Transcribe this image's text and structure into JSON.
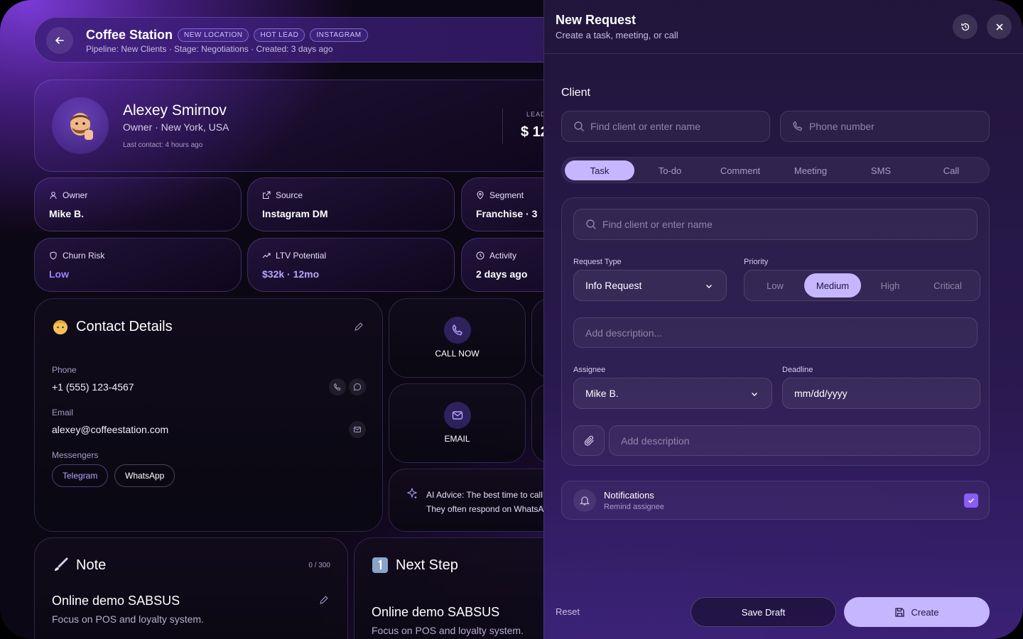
{
  "header": {
    "title": "Coffee Station",
    "tags": [
      "NEW LOCATION",
      "HOT LEAD",
      "INSTAGRAM"
    ],
    "subtitle": "Pipeline: New Clients · Stage: Negotiations · Created: 3 days ago"
  },
  "profile": {
    "name": "Alexey Smirnov",
    "role": "Owner · New York, USA",
    "last_contact": "Last contact: 4 hours ago",
    "lead_label": "LEAD",
    "lead_value": "$ 12"
  },
  "stats": [
    {
      "label": "Owner",
      "value": "Mike B."
    },
    {
      "label": "Source",
      "value": "Instagram DM"
    },
    {
      "label": "Segment",
      "value": "Franchise · 3"
    },
    {
      "label": "Churn Risk",
      "value": "Low"
    },
    {
      "label": "LTV Potential",
      "value": "$32k · 12mo"
    },
    {
      "label": "Activity",
      "value": "2 days ago"
    }
  ],
  "contact": {
    "title": "Contact Details",
    "phone_label": "Phone",
    "phone": "+1 (555) 123-4567",
    "email_label": "Email",
    "email": "alexey@coffeestation.com",
    "messengers_label": "Messengers",
    "messengers": [
      "Telegram",
      "WhatsApp"
    ]
  },
  "actions": {
    "call": "CALL NOW",
    "email": "EMAIL"
  },
  "advice": {
    "line1": "AI Advice: The best time to call t",
    "line2": "They often respond on WhatsAp"
  },
  "note": {
    "title": "Note",
    "counter": "0 / 300",
    "heading": "Online demo SABSUS",
    "text": "Focus on POS and loyalty system."
  },
  "next_step": {
    "title": "Next Step",
    "heading": "Online demo SABSUS",
    "text": "Focus on POS and loyalty system."
  },
  "panel": {
    "title": "New Request",
    "subtitle": "Create a task, meeting, or call",
    "client_label": "Client",
    "client_placeholder": "Find client or enter name",
    "phone_placeholder": "Phone number",
    "tabs": [
      "Task",
      "To-do",
      "Comment",
      "Meeting",
      "SMS",
      "Call"
    ],
    "active_tab": "Task",
    "search_placeholder": "Find client or enter name",
    "request_type_label": "Request Type",
    "request_type": "Info Request",
    "priority_label": "Priority",
    "priorities": [
      "Low",
      "Medium",
      "High",
      "Critical"
    ],
    "active_priority": "Medium",
    "description_placeholder": "Add description...",
    "assignee_label": "Assignee",
    "assignee": "Mike B.",
    "deadline_label": "Deadline",
    "deadline_placeholder": "mm/dd/yyyy",
    "attachment_placeholder": "Add description",
    "notifications_title": "Notifications",
    "notifications_sub": "Remind assignee",
    "notifications_checked": true,
    "reset": "Reset",
    "save_draft": "Save Draft",
    "create": "Create"
  },
  "colors": {
    "accent": "#c6b6ff",
    "risk_low": "#9b86ff",
    "ltv": "#b7a6ff",
    "checkbox": "#8b5cf6"
  }
}
